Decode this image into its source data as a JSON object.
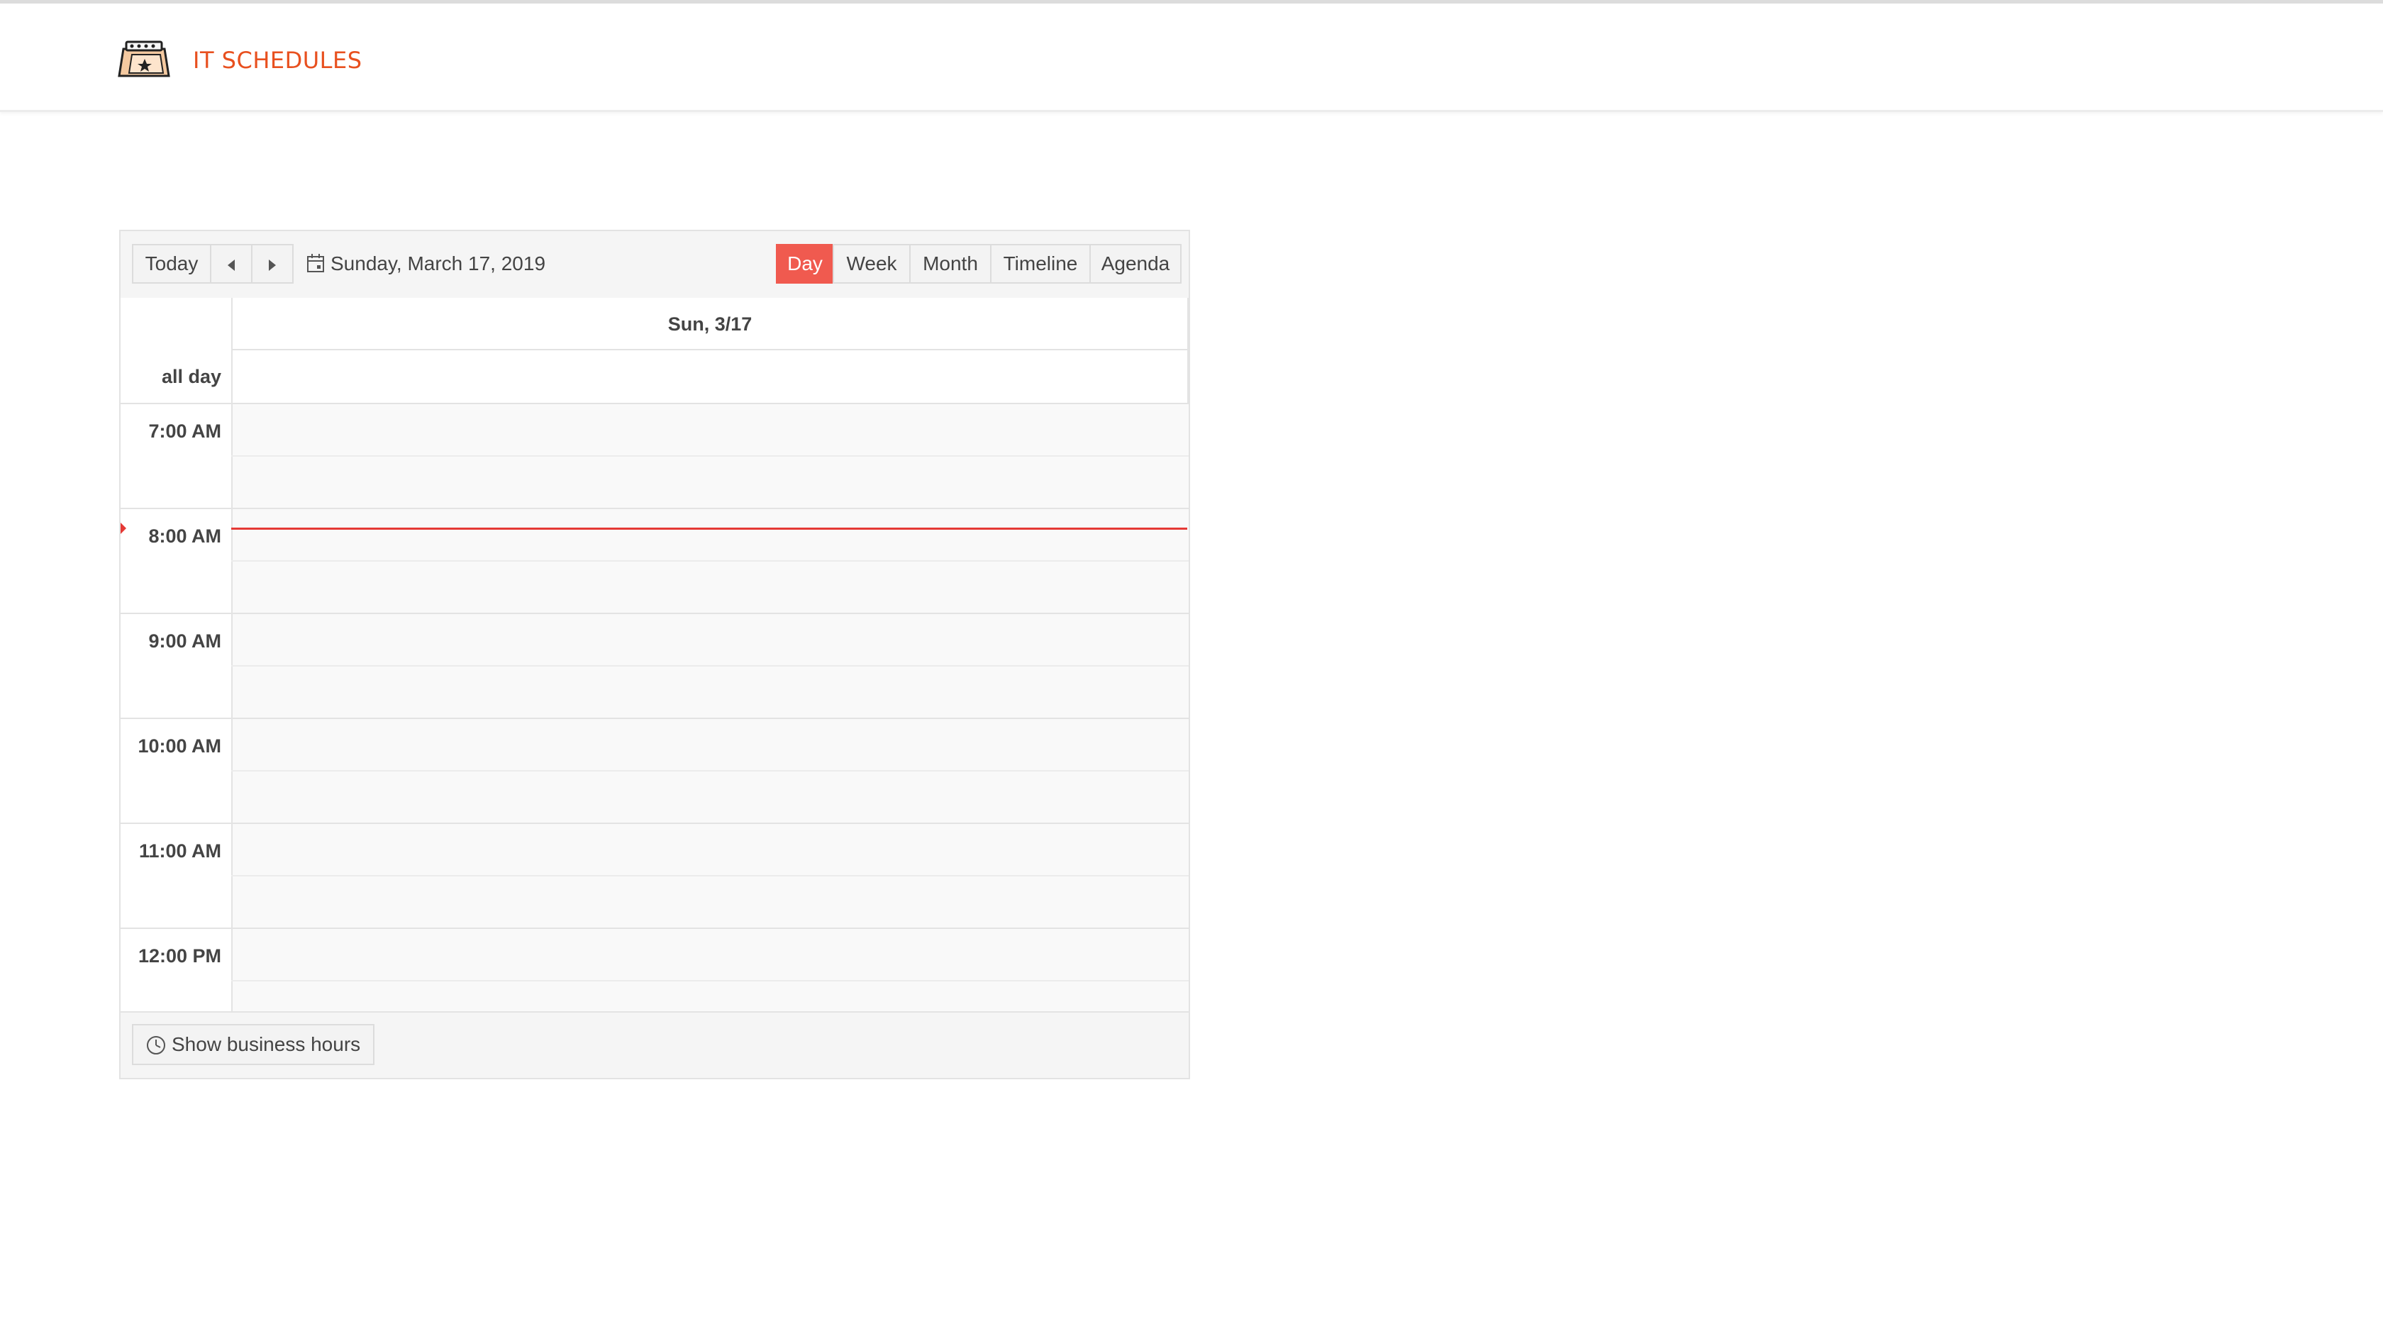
{
  "header": {
    "brand": "IT SCHEDULES",
    "logo_icon": "calendar-clip-icon",
    "brand_color": "#e8501f"
  },
  "toolbar": {
    "today_label": "Today",
    "prev_icon": "arrow-left-icon",
    "next_icon": "arrow-right-icon",
    "date_label": "Sunday, March 17, 2019",
    "views": [
      {
        "label": "Day",
        "selected": true
      },
      {
        "label": "Week",
        "selected": false
      },
      {
        "label": "Month",
        "selected": false
      },
      {
        "label": "Timeline",
        "selected": false
      },
      {
        "label": "Agenda",
        "selected": false
      }
    ],
    "selected_color": "#f05a4f"
  },
  "grid": {
    "day_header": "Sun, 3/17",
    "allday_label": "all day",
    "hours": [
      "7:00 AM",
      "8:00 AM",
      "9:00 AM",
      "10:00 AM",
      "11:00 AM",
      "12:00 PM"
    ],
    "now_indicator_color": "#e53935"
  },
  "footer": {
    "business_hours_label": "Show business hours",
    "icon": "clock-icon"
  }
}
